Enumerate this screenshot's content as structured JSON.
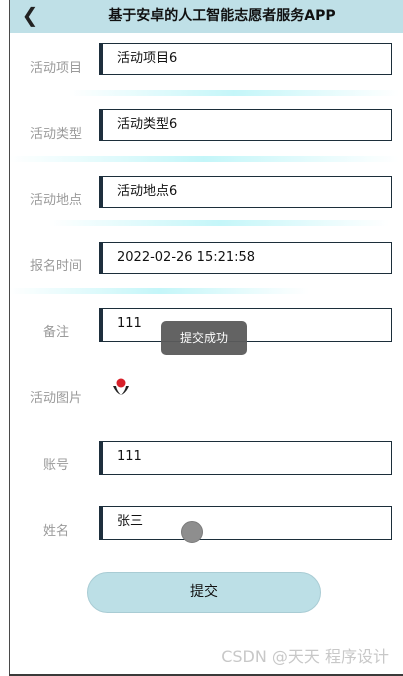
{
  "header": {
    "back_icon": "chevron-left-icon",
    "title": "基于安卓的人工智能志愿者服务APP"
  },
  "form": {
    "activity_item": {
      "label": "活动项目",
      "value": "活动项目6"
    },
    "activity_type": {
      "label": "活动类型",
      "value": "活动类型6"
    },
    "activity_location": {
      "label": "活动地点",
      "value": "活动地点6"
    },
    "signup_time": {
      "label": "报名时间",
      "value": "2022-02-26 15:21:58"
    },
    "remark": {
      "label": "备注",
      "value": "111"
    },
    "activity_image": {
      "label": "活动图片",
      "icon": "volunteer-logo-icon"
    },
    "account": {
      "label": "账号",
      "value": "111"
    },
    "name": {
      "label": "姓名",
      "value": "张三"
    }
  },
  "toast": {
    "text": "提交成功"
  },
  "submit_label": "提交",
  "watermark": "CSDN @天天 程序设计",
  "colors": {
    "header_bg": "#bfe0e7",
    "submit_bg": "#bcdfe6",
    "field_accent": "#1e2f3d",
    "toast_bg": "#5b5b5b",
    "label_text": "#9a9a9a"
  }
}
